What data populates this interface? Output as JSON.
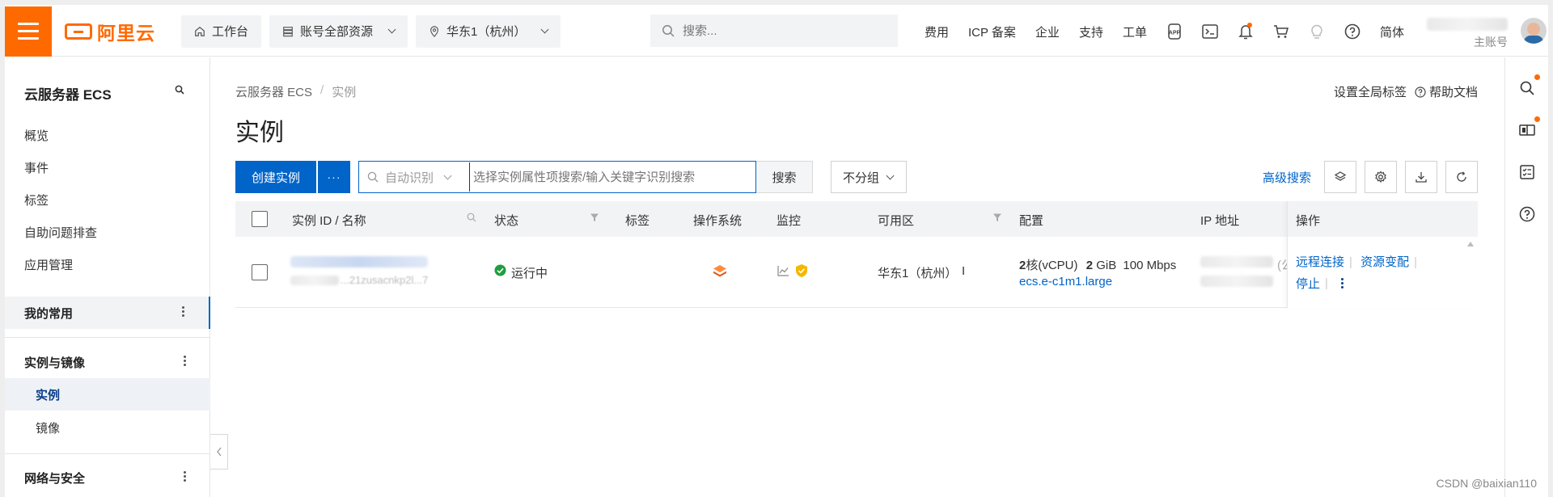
{
  "brand": {
    "logo_text": "阿里云",
    "accent": "#ff6a00",
    "primary": "#0064c8"
  },
  "topbar": {
    "workbench": "工作台",
    "resources": "账号全部资源",
    "region": "华东1（杭州）",
    "search_placeholder": "搜索...",
    "links": [
      "费用",
      "ICP 备案",
      "企业",
      "支持",
      "工单"
    ],
    "lang": "简体",
    "account_label": "主账号"
  },
  "sidebar": {
    "title": "云服务器 ECS",
    "items": [
      "概览",
      "事件",
      "标签",
      "自助问题排查",
      "应用管理"
    ],
    "groups": {
      "favorites": "我的常用",
      "instances_images": "实例与镜像",
      "network_security": "网络与安全"
    },
    "sub_items": [
      "实例",
      "镜像"
    ]
  },
  "main": {
    "breadcrumb": [
      "云服务器 ECS",
      "实例"
    ],
    "title": "实例",
    "global_tags": "设置全局标签",
    "help_docs": "帮助文档",
    "create_button": "创建实例",
    "more_button": "···",
    "search_scope": "自动识别",
    "search_placeholder": "选择实例属性项搜索/输入关键字识别搜索",
    "search_button": "搜索",
    "group_select": "不分组",
    "advanced_search": "高级搜索"
  },
  "table": {
    "columns": {
      "id_name": "实例 ID / 名称",
      "status": "状态",
      "tags": "标签",
      "os": "操作系统",
      "monitor": "监控",
      "zone": "可用区",
      "config": "配置",
      "ip": "IP 地址",
      "actions": "操作"
    },
    "rows": [
      {
        "id_partial": "...21zusacnkp2l...7",
        "status": "运行中",
        "zone": "华东1（杭州）",
        "zone_suffix": "I",
        "cpu_num": "2",
        "cpu_unit": "核(vCPU)",
        "mem_num": "2",
        "mem_unit": "GiB",
        "bandwidth": "100 Mbps",
        "spec": "ecs.e-c1m1.large",
        "ip_suffix": "(公",
        "actions": [
          "远程连接",
          "资源变配",
          "停止"
        ]
      }
    ]
  },
  "status_color": "#1e9e3f",
  "watermark": "CSDN @baixian110"
}
